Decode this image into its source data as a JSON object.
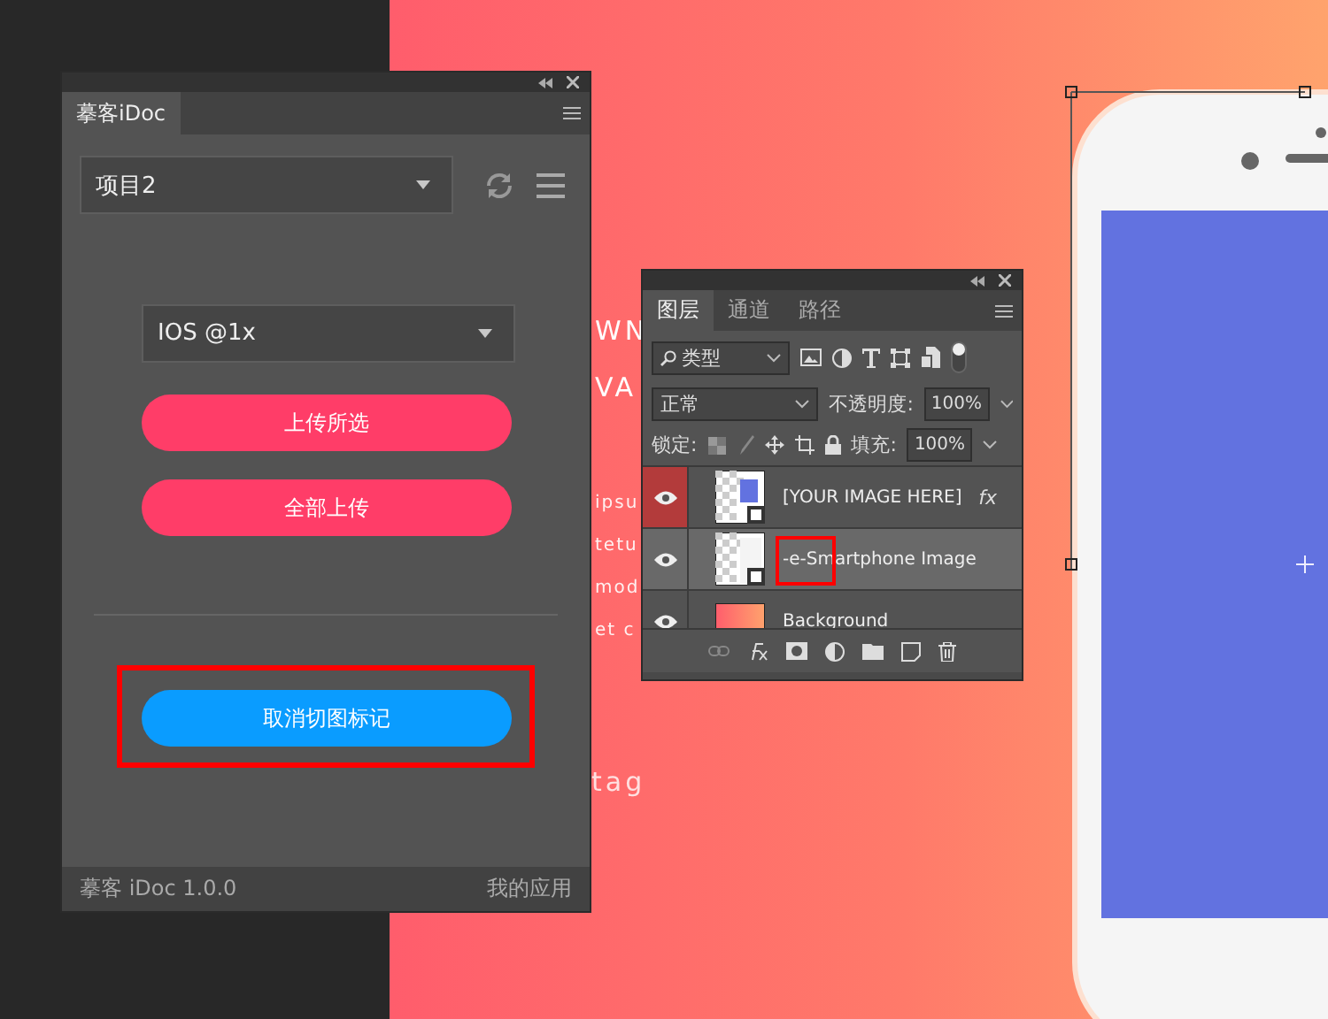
{
  "plugin_panel": {
    "tab": "摹客iDoc",
    "project_select": {
      "value": "项目2"
    },
    "scale_select": {
      "value": "IOS @1x"
    },
    "buttons": [
      {
        "label": "上传所选",
        "kind": "primary",
        "marked": false
      },
      {
        "label": "全部上传",
        "kind": "primary",
        "marked": false
      },
      {
        "label": "取消切图标记",
        "kind": "secondary",
        "marked": true
      }
    ],
    "footer": {
      "version": "摹客 iDoc 1.0.0",
      "link": "我的应用"
    }
  },
  "canvas_text": [
    {
      "text": "WN",
      "kind": "heading"
    },
    {
      "text": "VA",
      "kind": "heading"
    },
    {
      "text": "ipsu",
      "kind": "body"
    },
    {
      "text": "tetu",
      "kind": "body"
    },
    {
      "text": "mod",
      "kind": "body"
    },
    {
      "text": "et c",
      "kind": "body"
    },
    {
      "text": "tag",
      "kind": "tag"
    }
  ],
  "layers_panel": {
    "tabs": [
      {
        "label": "图层",
        "selected": true
      },
      {
        "label": "通道",
        "selected": false
      },
      {
        "label": "路径",
        "selected": false
      }
    ],
    "filter": {
      "value": "类型"
    },
    "blend_mode": {
      "value": "正常"
    },
    "opacity_label": "不透明度:",
    "opacity": "100%",
    "lock_label": "锁定:",
    "fill_label": "填充:",
    "fill": "100%",
    "layers": [
      {
        "name": "[YOUR IMAGE HERE]",
        "kind": "image",
        "selected": false,
        "eye_highlighted": true,
        "fx": "fx",
        "marked": false
      },
      {
        "name": "-e-Smartphone Image",
        "kind": "smartphone",
        "selected": true,
        "eye_highlighted": false,
        "marked": true
      },
      {
        "name": "Background",
        "kind": "gradient",
        "selected": false,
        "eye_highlighted": false,
        "marked": false
      }
    ]
  }
}
